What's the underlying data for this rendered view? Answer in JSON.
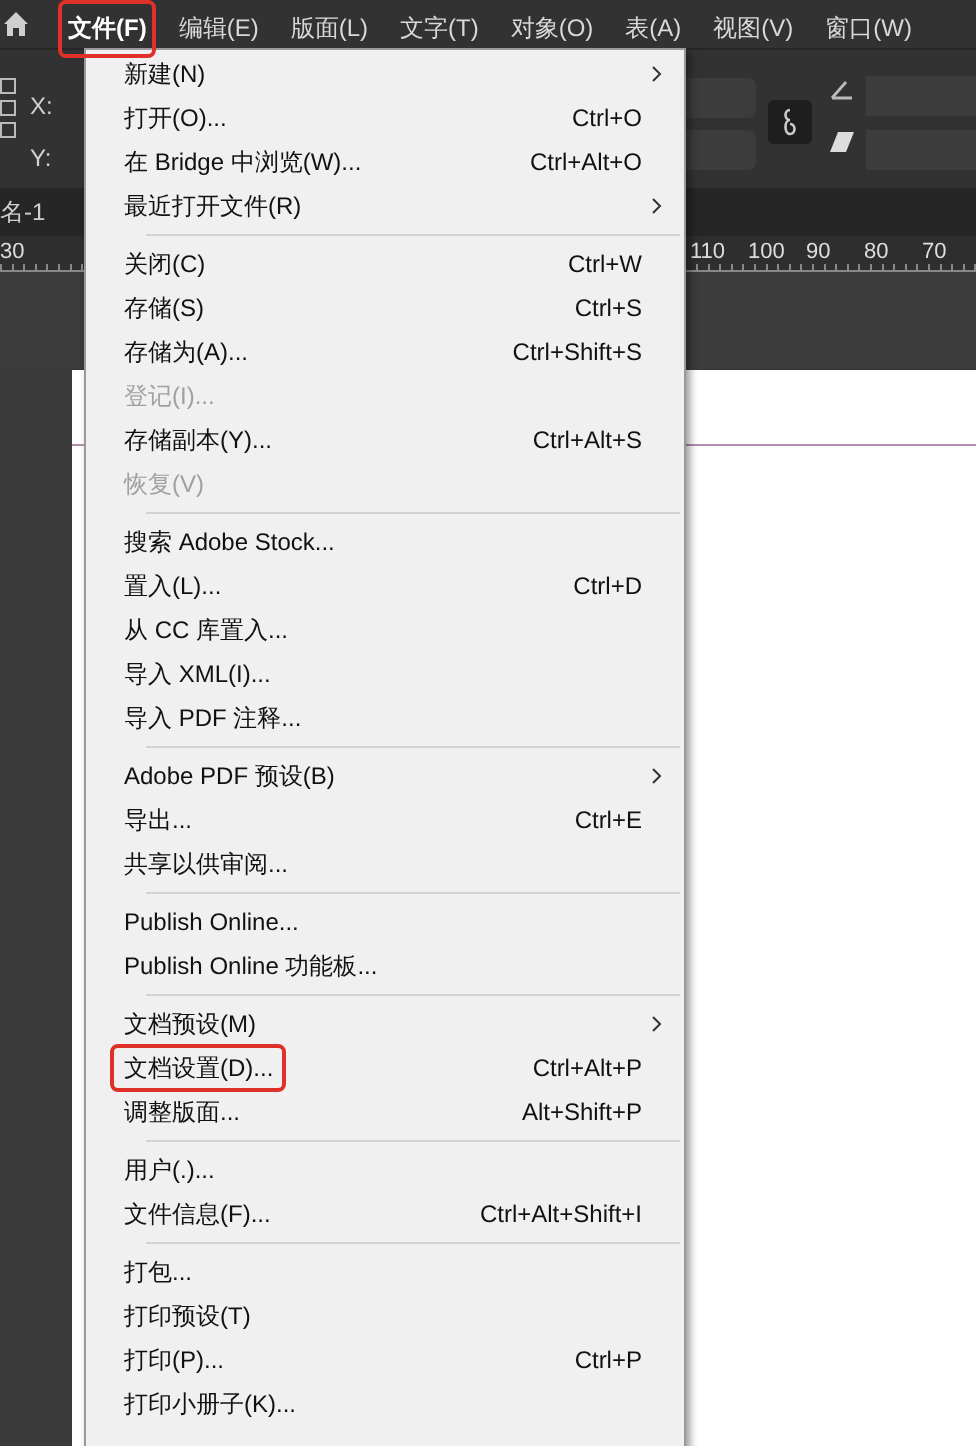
{
  "menubar": [
    {
      "label": "文件(F)",
      "selected": true,
      "annotated": true
    },
    {
      "label": "编辑(E)",
      "selected": false,
      "annotated": false
    },
    {
      "label": "版面(L)",
      "selected": false,
      "annotated": false
    },
    {
      "label": "文字(T)",
      "selected": false,
      "annotated": false
    },
    {
      "label": "对象(O)",
      "selected": false,
      "annotated": false
    },
    {
      "label": "表(A)",
      "selected": false,
      "annotated": false
    },
    {
      "label": "视图(V)",
      "selected": false,
      "annotated": false
    },
    {
      "label": "窗口(W)",
      "selected": false,
      "annotated": false
    }
  ],
  "control_panel": {
    "x_label": "X:",
    "y_label": "Y:"
  },
  "document_tab": {
    "title": "名-1"
  },
  "ruler": {
    "left_labels": [
      "30"
    ],
    "right_labels": [
      "110",
      "100",
      "90",
      "80",
      "70"
    ]
  },
  "file_menu": {
    "groups": [
      [
        {
          "label": "新建(N)",
          "submenu": true,
          "disabled": false,
          "annotated": false
        },
        {
          "label": "打开(O)...",
          "shortcut": "Ctrl+O",
          "submenu": false,
          "disabled": false,
          "annotated": false
        },
        {
          "label": "在 Bridge 中浏览(W)...",
          "shortcut": "Ctrl+Alt+O",
          "submenu": false,
          "disabled": false,
          "annotated": false
        },
        {
          "label": "最近打开文件(R)",
          "submenu": true,
          "disabled": false,
          "annotated": false
        }
      ],
      [
        {
          "label": "关闭(C)",
          "shortcut": "Ctrl+W",
          "submenu": false,
          "disabled": false,
          "annotated": false
        },
        {
          "label": "存储(S)",
          "shortcut": "Ctrl+S",
          "submenu": false,
          "disabled": false,
          "annotated": false
        },
        {
          "label": "存储为(A)...",
          "shortcut": "Ctrl+Shift+S",
          "submenu": false,
          "disabled": false,
          "annotated": false
        },
        {
          "label": "登记(I)...",
          "submenu": false,
          "disabled": true,
          "annotated": false
        },
        {
          "label": "存储副本(Y)...",
          "shortcut": "Ctrl+Alt+S",
          "submenu": false,
          "disabled": false,
          "annotated": false
        },
        {
          "label": "恢复(V)",
          "submenu": false,
          "disabled": true,
          "annotated": false
        }
      ],
      [
        {
          "label": "搜索 Adobe Stock...",
          "submenu": false,
          "disabled": false,
          "annotated": false
        },
        {
          "label": "置入(L)...",
          "shortcut": "Ctrl+D",
          "submenu": false,
          "disabled": false,
          "annotated": false
        },
        {
          "label": "从 CC 库置入...",
          "submenu": false,
          "disabled": false,
          "annotated": false
        },
        {
          "label": "导入 XML(I)...",
          "submenu": false,
          "disabled": false,
          "annotated": false
        },
        {
          "label": "导入 PDF 注释...",
          "submenu": false,
          "disabled": false,
          "annotated": false
        }
      ],
      [
        {
          "label": "Adobe PDF 预设(B)",
          "submenu": true,
          "disabled": false,
          "annotated": false
        },
        {
          "label": "导出...",
          "shortcut": "Ctrl+E",
          "submenu": false,
          "disabled": false,
          "annotated": false
        },
        {
          "label": "共享以供审阅...",
          "submenu": false,
          "disabled": false,
          "annotated": false
        }
      ],
      [
        {
          "label": "Publish Online...",
          "submenu": false,
          "disabled": false,
          "annotated": false
        },
        {
          "label": "Publish Online 功能板...",
          "submenu": false,
          "disabled": false,
          "annotated": false
        }
      ],
      [
        {
          "label": "文档预设(M)",
          "submenu": true,
          "disabled": false,
          "annotated": false
        },
        {
          "label": "文档设置(D)...",
          "shortcut": "Ctrl+Alt+P",
          "submenu": false,
          "disabled": false,
          "annotated": true
        },
        {
          "label": "调整版面...",
          "shortcut": "Alt+Shift+P",
          "submenu": false,
          "disabled": false,
          "annotated": false
        }
      ],
      [
        {
          "label": "用户(.)...",
          "submenu": false,
          "disabled": false,
          "annotated": false
        },
        {
          "label": "文件信息(F)...",
          "shortcut": "Ctrl+Alt+Shift+I",
          "submenu": false,
          "disabled": false,
          "annotated": false
        }
      ],
      [
        {
          "label": "打包...",
          "submenu": false,
          "disabled": false,
          "annotated": false
        },
        {
          "label": "打印预设(T)",
          "submenu": false,
          "disabled": false,
          "annotated": false
        },
        {
          "label": "打印(P)...",
          "shortcut": "Ctrl+P",
          "submenu": false,
          "disabled": false,
          "annotated": false
        },
        {
          "label": "打印小册子(K)...",
          "submenu": false,
          "disabled": false,
          "annotated": false
        }
      ]
    ]
  }
}
